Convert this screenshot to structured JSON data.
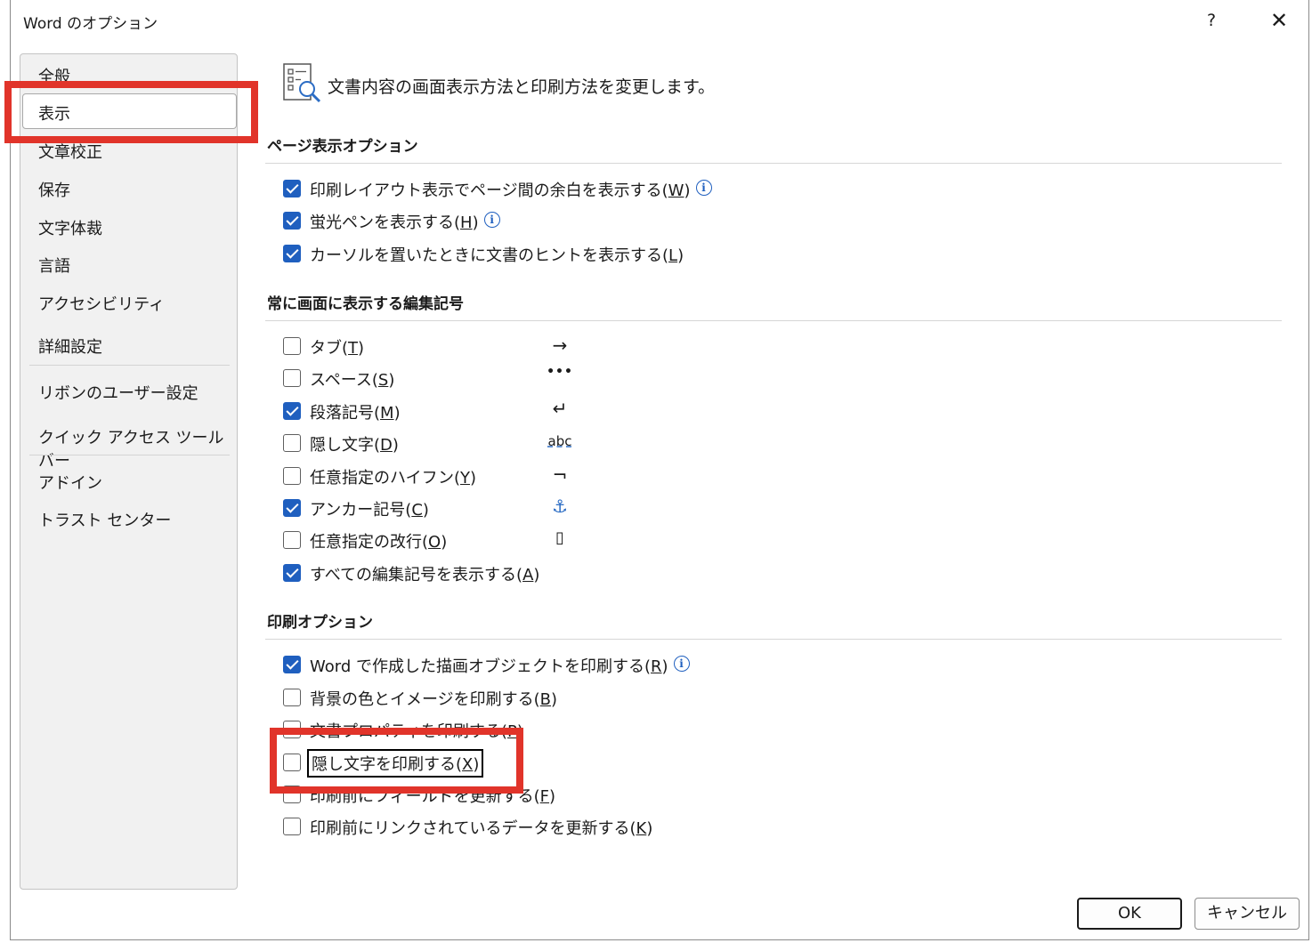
{
  "window": {
    "title": "Word のオプション",
    "help_glyph": "?",
    "close_glyph": "✕"
  },
  "sidebar": {
    "items": [
      {
        "label": "全般"
      },
      {
        "label": "表示",
        "selected": true
      },
      {
        "label": "文章校正"
      },
      {
        "label": "保存"
      },
      {
        "label": "文字体裁"
      },
      {
        "label": "言語"
      },
      {
        "label": "アクセシビリティ"
      },
      {
        "label": "詳細設定"
      },
      {
        "label": "リボンのユーザー設定"
      },
      {
        "label": "クイック アクセス ツール バー"
      },
      {
        "label": "アドイン"
      },
      {
        "label": "トラスト センター"
      }
    ]
  },
  "header": {
    "icon": "display-options-icon",
    "text": "文書内容の画面表示方法と印刷方法を変更します。"
  },
  "sections": {
    "page_display": {
      "title": "ページ表示オプション",
      "options": [
        {
          "label": "印刷レイアウト表示でページ間の余白を表示する",
          "key": "W",
          "checked": true,
          "info": true
        },
        {
          "label": "蛍光ペンを表示する",
          "key": "H",
          "checked": true,
          "info": true
        },
        {
          "label": "カーソルを置いたときに文書のヒントを表示する",
          "key": "L",
          "checked": true,
          "info": false
        }
      ]
    },
    "formatting_marks": {
      "title": "常に画面に表示する編集記号",
      "options": [
        {
          "label": "タブ",
          "key": "T",
          "checked": false,
          "symbol": "→"
        },
        {
          "label": "スペース",
          "key": "S",
          "checked": false,
          "symbol": "•••"
        },
        {
          "label": "段落記号",
          "key": "M",
          "checked": true,
          "symbol": "↵"
        },
        {
          "label": "隠し文字",
          "key": "D",
          "checked": false,
          "symbol": "abc"
        },
        {
          "label": "任意指定のハイフン",
          "key": "Y",
          "checked": false,
          "symbol": "¬"
        },
        {
          "label": "アンカー記号",
          "key": "C",
          "checked": true,
          "symbol": "⚓"
        },
        {
          "label": "任意指定の改行",
          "key": "O",
          "checked": false,
          "symbol": "▯"
        },
        {
          "label": "すべての編集記号を表示する",
          "key": "A",
          "checked": true
        }
      ]
    },
    "print": {
      "title": "印刷オプション",
      "options": [
        {
          "label": "Word で作成した描画オブジェクトを印刷する",
          "key": "R",
          "checked": true,
          "info": true
        },
        {
          "label": "背景の色とイメージを印刷する",
          "key": "B",
          "checked": false
        },
        {
          "label": "文書プロパティを印刷する",
          "key": "P",
          "checked": false
        },
        {
          "label": "隠し文字を印刷する",
          "key": "X",
          "checked": false,
          "focused": true
        },
        {
          "label": "印刷前にフィールドを更新する",
          "key": "F",
          "checked": false
        },
        {
          "label": "印刷前にリンクされているデータを更新する",
          "key": "K",
          "checked": false
        }
      ]
    }
  },
  "buttons": {
    "ok": "OK",
    "cancel": "キャンセル"
  },
  "colors": {
    "checkbox_checked": "#1f5fbf",
    "highlight": "#e1342a",
    "info": "#1f5fbf"
  }
}
